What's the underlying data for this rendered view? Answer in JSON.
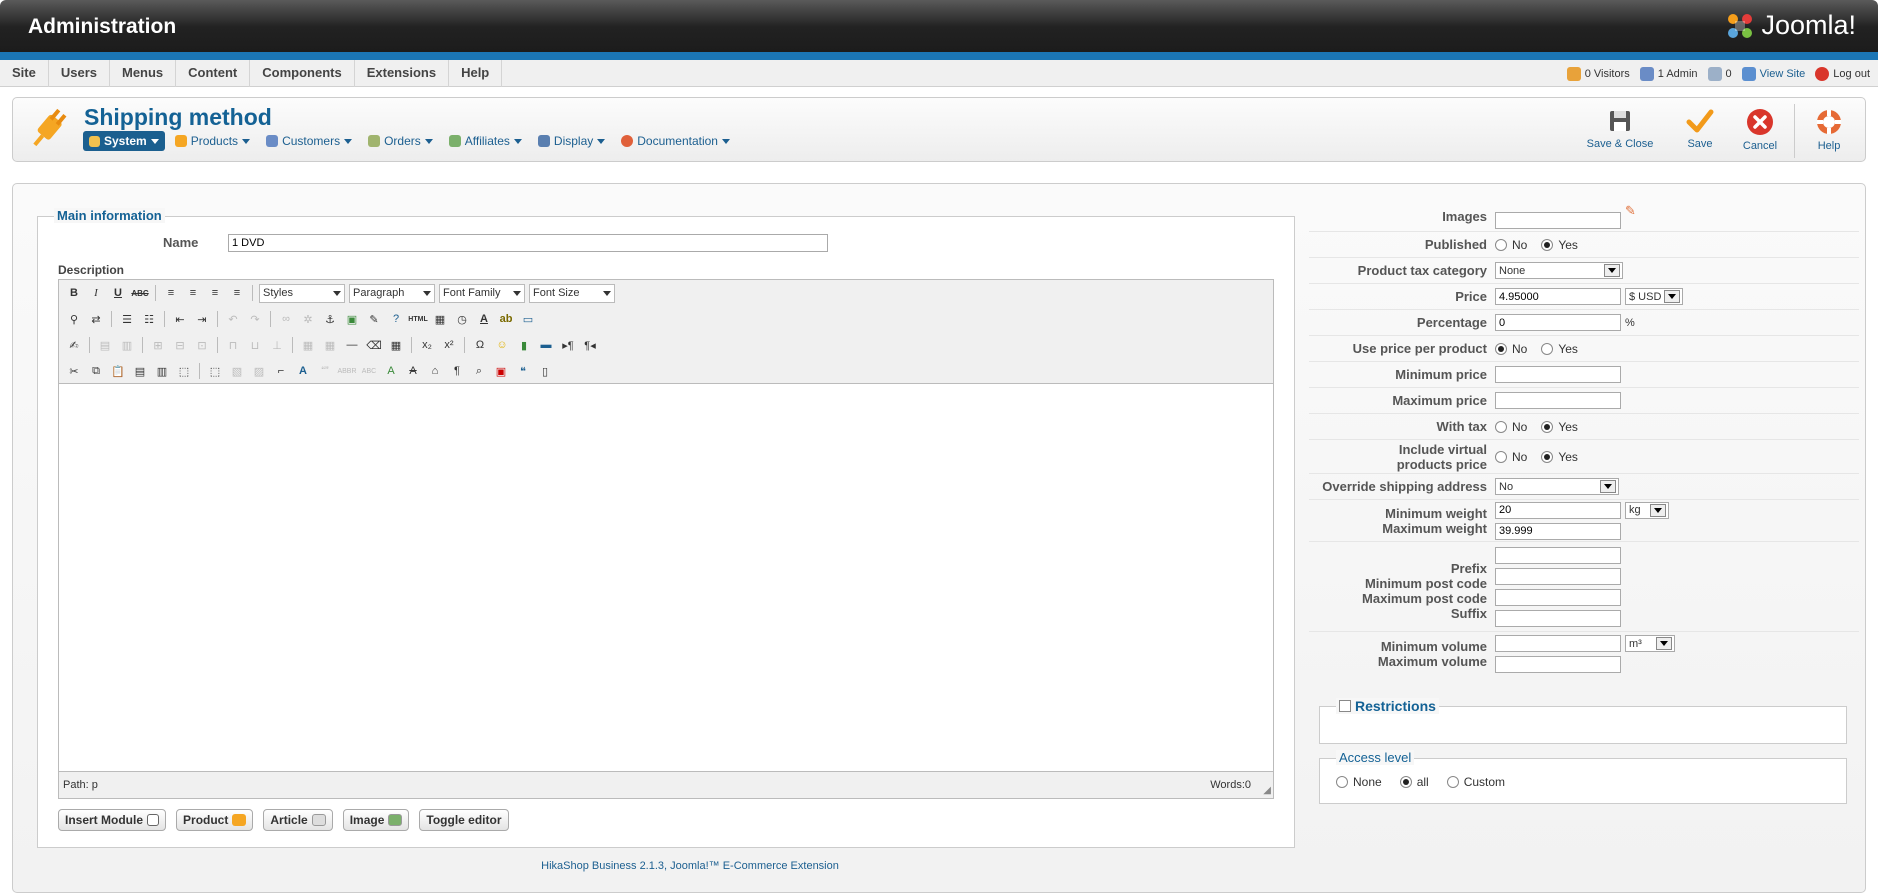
{
  "header": {
    "title": "Administration",
    "logo_text": "Joomla!"
  },
  "menubar": {
    "items": [
      "Site",
      "Users",
      "Menus",
      "Content",
      "Components",
      "Extensions",
      "Help"
    ],
    "status": {
      "visitors": "0 Visitors",
      "admins": "1 Admin",
      "messages": "0",
      "view_site": "View Site",
      "logout": "Log out"
    }
  },
  "toolbar": {
    "page_title": "Shipping method",
    "submenu": [
      "System",
      "Products",
      "Customers",
      "Orders",
      "Affiliates",
      "Display",
      "Documentation"
    ],
    "buttons": {
      "save_close": "Save & Close",
      "save": "Save",
      "cancel": "Cancel",
      "help": "Help"
    }
  },
  "main": {
    "legend": "Main information",
    "name_label": "Name",
    "name_value": "1 DVD",
    "description_label": "Description",
    "editor": {
      "styles": "Styles",
      "paragraph": "Paragraph",
      "font_family": "Font Family",
      "font_size": "Font Size",
      "path": "Path: p",
      "words": "Words:0"
    },
    "editor_buttons": [
      "Insert Module",
      "Product",
      "Article",
      "Image",
      "Toggle editor"
    ]
  },
  "form": {
    "images_label": "Images",
    "published_label": "Published",
    "published": {
      "no": "No",
      "yes": "Yes",
      "selected": "Yes"
    },
    "tax_label": "Product tax category",
    "tax_value": "None",
    "price_label": "Price",
    "price_value": "4.95000",
    "currency": "$ USD",
    "percentage_label": "Percentage",
    "percentage_value": "0",
    "percent_sign": "%",
    "price_per_product_label": "Use price per product",
    "price_per_product": {
      "no": "No",
      "yes": "Yes",
      "selected": "No"
    },
    "min_price_label": "Minimum price",
    "max_price_label": "Maximum price",
    "with_tax_label": "With tax",
    "with_tax": {
      "no": "No",
      "yes": "Yes",
      "selected": "Yes"
    },
    "include_virtual_label_1": "Include virtual",
    "include_virtual_label_2": "products price",
    "include_virtual": {
      "no": "No",
      "yes": "Yes",
      "selected": "Yes"
    },
    "override_label": "Override shipping address",
    "override_value": "No",
    "min_weight_label": "Minimum weight",
    "min_weight_value": "20",
    "weight_unit": "kg",
    "max_weight_label": "Maximum weight",
    "max_weight_value": "39.999",
    "prefix_label": "Prefix",
    "min_post_label": "Minimum post code",
    "max_post_label": "Maximum post code",
    "suffix_label": "Suffix",
    "min_volume_label": "Minimum volume",
    "volume_unit": "m³",
    "max_volume_label": "Maximum volume"
  },
  "restrictions": {
    "label": "Restrictions"
  },
  "access": {
    "label": "Access level",
    "none": "None",
    "all": "all",
    "custom": "Custom",
    "selected": "all"
  },
  "footer": "HikaShop Business 2.1.3, Joomla!™ E-Commerce Extension",
  "colors": {
    "accent": "#146295",
    "header_bar": "#1b76b6",
    "active_menu": "#1b5f8f",
    "cancel_red": "#d9362b",
    "save_orange": "#f29a1a"
  }
}
